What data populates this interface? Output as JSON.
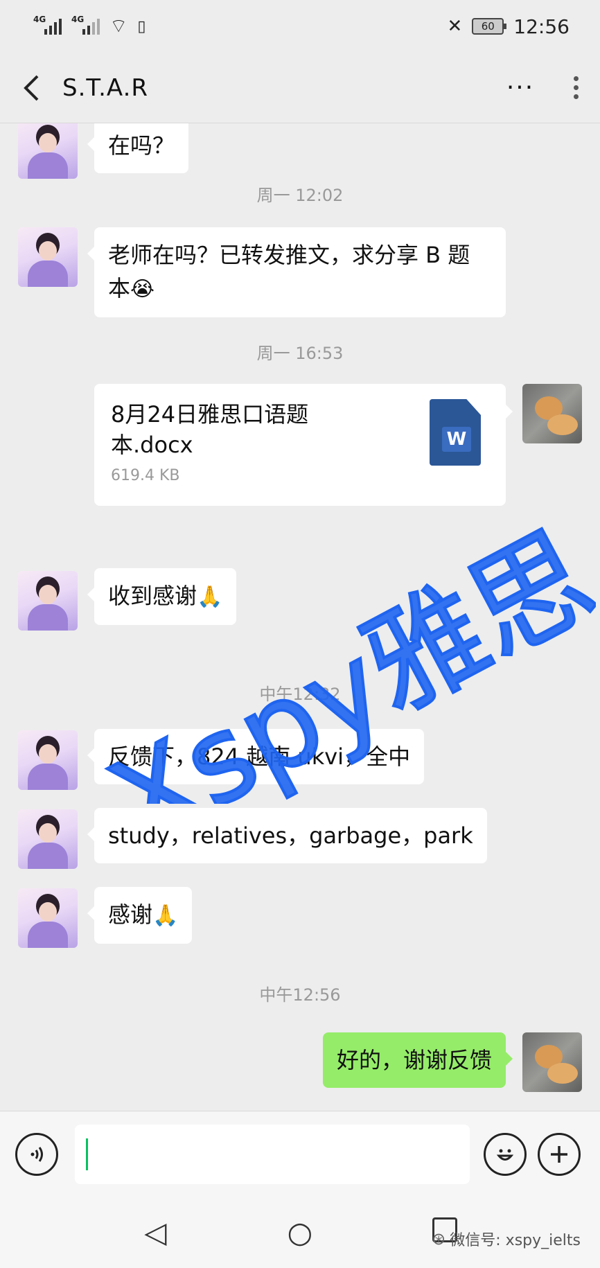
{
  "status_bar": {
    "signal1_label": "4G",
    "signal2_label": "4G",
    "wifi_icon": "wifi-icon",
    "battery_level": "60",
    "time": "12:56"
  },
  "header": {
    "back_icon": "‹",
    "title": "S.T.A.R",
    "more_label": "···"
  },
  "messages": {
    "m1": {
      "text": "在吗？"
    },
    "ts1": "周一 12:02",
    "m2": {
      "text": "老师在吗？已转发推文，求分享 B 题本",
      "emoji": "😭"
    },
    "ts2": "周一 16:53",
    "file": {
      "name": "8月24日雅思口语题本.docx",
      "size": "619.4 KB",
      "icon_label": "W"
    },
    "m3": {
      "text": "收到感谢",
      "emoji": "🙏"
    },
    "ts3": "中午12:32",
    "m4": {
      "text": "反馈下，824 越南 ukvi，全中"
    },
    "m5": {
      "text": "study，relatives，garbage，park"
    },
    "m6": {
      "text": "感谢",
      "emoji": "🙏"
    },
    "ts4": "中午12:56",
    "m7": {
      "text": "好的，谢谢反馈"
    }
  },
  "watermark": {
    "text": "Xspy雅思",
    "color": "#1e64f0"
  },
  "input_bar": {
    "voice_icon": "voice-icon",
    "emoji_icon": "emoji-icon",
    "plus_icon": "plus-icon",
    "value": ""
  },
  "nav_bar": {
    "back_glyph": "◁",
    "home_glyph": "○"
  },
  "brand": {
    "text": "微信号: xspy_ielts"
  },
  "colors": {
    "background": "#ededed",
    "outgoing_bubble": "#95ec69",
    "incoming_bubble": "#ffffff",
    "timestamp": "#999999"
  }
}
